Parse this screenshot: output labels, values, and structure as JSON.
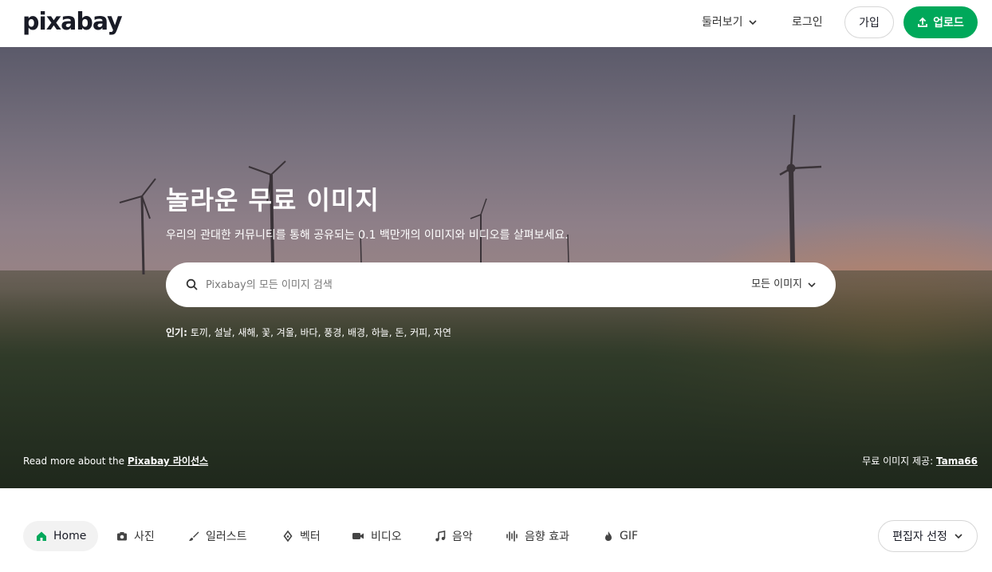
{
  "header": {
    "logo": "pixabay",
    "explore_label": "둘러보기",
    "login_label": "로그인",
    "join_label": "가입",
    "upload_label": "업로드",
    "brand_color": "#00a85a"
  },
  "hero": {
    "title": "놀라운 무료 이미지",
    "subtitle": "우리의 관대한 커뮤니티를 통해 공유되는 0.1 백만개의 이미지와 비디오를 살펴보세요.",
    "search_placeholder": "Pixabay의 모든 이미지 검색",
    "search_type": "모든 이미지",
    "popular_label": "인기:",
    "popular_tags": [
      "토끼,",
      "설날,",
      "새해,",
      "꽃,",
      "겨울,",
      "바다,",
      "풍경,",
      "배경,",
      "하늘,",
      "돈,",
      "커피,",
      "자연"
    ],
    "license_text": "Read more about the",
    "license_link": "Pixabay 라이선스",
    "credit_text": "무료 이미지 제공:",
    "credit_link": "Tama66"
  },
  "categories": {
    "items": [
      {
        "label": "Home",
        "icon": "home-icon",
        "active": true
      },
      {
        "label": "사진",
        "icon": "camera-icon"
      },
      {
        "label": "일러스트",
        "icon": "brush-icon"
      },
      {
        "label": "벡터",
        "icon": "pen-nib-icon"
      },
      {
        "label": "비디오",
        "icon": "video-icon"
      },
      {
        "label": "음악",
        "icon": "music-note-icon"
      },
      {
        "label": "음향 효과",
        "icon": "sound-wave-icon"
      },
      {
        "label": "GIF",
        "icon": "flame-icon"
      }
    ],
    "editor_pick_label": "편집자 선정"
  }
}
